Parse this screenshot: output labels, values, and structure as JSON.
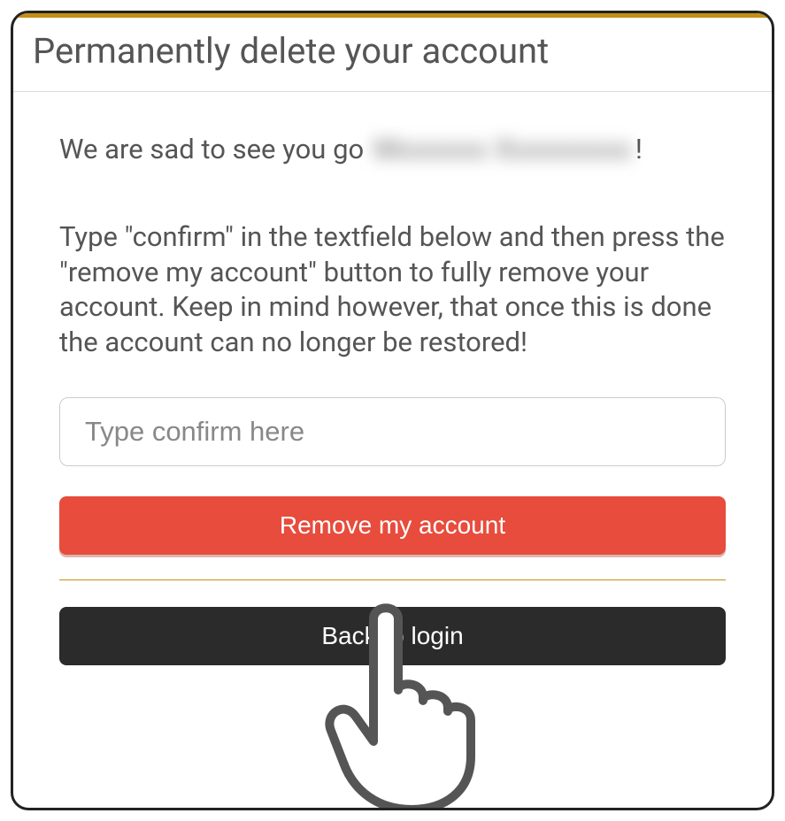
{
  "title": "Permanently delete your account",
  "sad": {
    "prefix": "We are sad to see you go ",
    "name_masked": "Mxxxxxx Xxxxxxxxx",
    "suffix": "!"
  },
  "instructions": "Type \"confirm\" in the textfield below and then press the \"remove my account\" button to fully remove your account. Keep in mind however, that once this is done the account can no longer be restored!",
  "input": {
    "placeholder": "Type confirm here",
    "value": ""
  },
  "buttons": {
    "remove": "Remove my account",
    "back": "Back to login"
  }
}
